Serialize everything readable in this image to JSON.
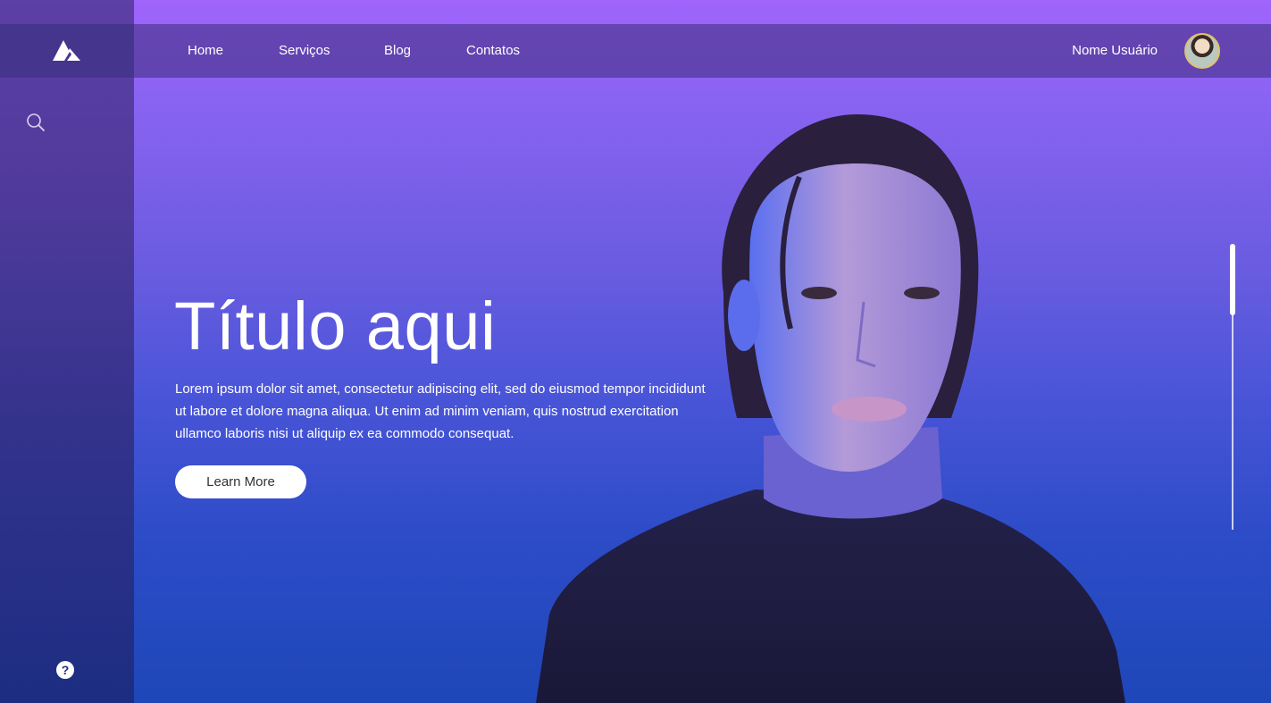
{
  "nav": {
    "items": [
      {
        "label": "Home"
      },
      {
        "label": "Serviços"
      },
      {
        "label": "Blog"
      },
      {
        "label": "Contatos"
      }
    ],
    "user_name": "Nome Usuário"
  },
  "hero": {
    "title": "Título aqui",
    "text": "Lorem ipsum dolor sit amet, consectetur adipiscing elit, sed do eiusmod tempor incididunt ut labore et dolore magna aliqua. Ut enim ad minim veniam, quis nostrud exercitation ullamco laboris nisi ut aliquip ex ea commodo consequat.",
    "button_label": "Learn More"
  },
  "sidebar": {
    "logo_icon": "mountain-logo-icon",
    "search_icon": "search-icon",
    "help_icon": "help-icon",
    "help_glyph": "?"
  },
  "colors": {
    "gradient_top": "#a064fb",
    "gradient_bottom": "#1e47b8",
    "sidebar": "#45358c"
  }
}
